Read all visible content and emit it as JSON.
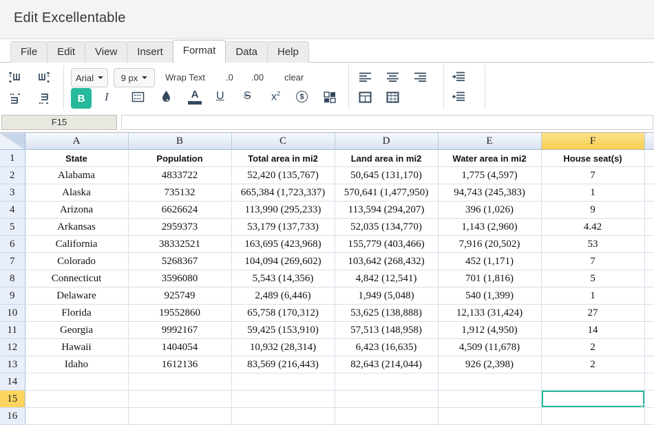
{
  "title": "Edit Excellentable",
  "tabs": {
    "items": [
      "File",
      "Edit",
      "View",
      "Insert",
      "Format",
      "Data",
      "Help"
    ],
    "active": "Format"
  },
  "toolbar": {
    "font_button": "Arial",
    "size_button": "9 px",
    "wrap_text_label": "Wrap Text",
    "decimal_decrease_label": ".0",
    "decimal_increase_label": ".00",
    "clear_label": "clear",
    "bold_label": "B",
    "italic_label": "I",
    "underline_label": "U",
    "strikethrough_label": "S",
    "superscript_base": "x",
    "superscript_exp": "2",
    "currency_symbol": "$",
    "font_color_letter": "A",
    "icons": [
      "insert-column-before-icon",
      "insert-column-after-icon",
      "insert-row-before-icon",
      "insert-row-after-icon",
      "borders-icon",
      "fill-color-icon",
      "font-color-icon",
      "merge-cells-icon",
      "align-left-icon",
      "align-center-icon",
      "align-right-icon",
      "border-outer-icon",
      "border-all-icon",
      "increase-indent-icon",
      "decrease-indent-icon",
      "currency-icon"
    ]
  },
  "formula_bar": {
    "cell_reference": "F15",
    "value": ""
  },
  "grid": {
    "columns": [
      "A",
      "B",
      "C",
      "D",
      "E",
      "F"
    ],
    "visible_rows": 16,
    "selected_cell": "F15",
    "selected_column": "F",
    "selected_row": 15,
    "header_row": [
      "State",
      "Population",
      "Total area in mi2",
      "Land area in mi2",
      "Water area in mi2",
      "House seat(s)"
    ],
    "data_rows": [
      [
        "Alabama",
        "4833722",
        "52,420 (135,767)",
        "50,645 (131,170)",
        "1,775 (4,597)",
        "7"
      ],
      [
        "Alaska",
        "735132",
        "665,384 (1,723,337)",
        "570,641 (1,477,950)",
        "94,743 (245,383)",
        "1"
      ],
      [
        "Arizona",
        "6626624",
        "113,990 (295,233)",
        "113,594 (294,207)",
        "396 (1,026)",
        "9"
      ],
      [
        "Arkansas",
        "2959373",
        "53,179 (137,733)",
        "52,035 (134,770)",
        "1,143 (2,960)",
        "4.42"
      ],
      [
        "California",
        "38332521",
        "163,695 (423,968)",
        "155,779 (403,466)",
        "7,916 (20,502)",
        "53"
      ],
      [
        "Colorado",
        "5268367",
        "104,094 (269,602)",
        "103,642 (268,432)",
        "452 (1,171)",
        "7"
      ],
      [
        "Connecticut",
        "3596080",
        "5,543 (14,356)",
        "4,842 (12,541)",
        "701 (1,816)",
        "5"
      ],
      [
        "Delaware",
        "925749",
        "2,489 (6,446)",
        "1,949 (5,048)",
        "540 (1,399)",
        "1"
      ],
      [
        "Florida",
        "19552860",
        "65,758 (170,312)",
        "53,625 (138,888)",
        "12,133 (31,424)",
        "27"
      ],
      [
        "Georgia",
        "9992167",
        "59,425 (153,910)",
        "57,513 (148,958)",
        "1,912 (4,950)",
        "14"
      ],
      [
        "Hawaii",
        "1404054",
        "10,932 (28,314)",
        "6,423 (16,635)",
        "4,509 (11,678)",
        "2"
      ],
      [
        "Idaho",
        "1612136",
        "83,569 (216,443)",
        "82,643 (214,044)",
        "926 (2,398)",
        "2"
      ]
    ]
  },
  "colors": {
    "accent_teal": "#26b99a",
    "selected_header_yellow": "#fbd55e",
    "icon_color": "#34495e",
    "column_header_gradient_top": "#f6f9fd",
    "column_header_gradient_bottom": "#d7e2f0"
  }
}
